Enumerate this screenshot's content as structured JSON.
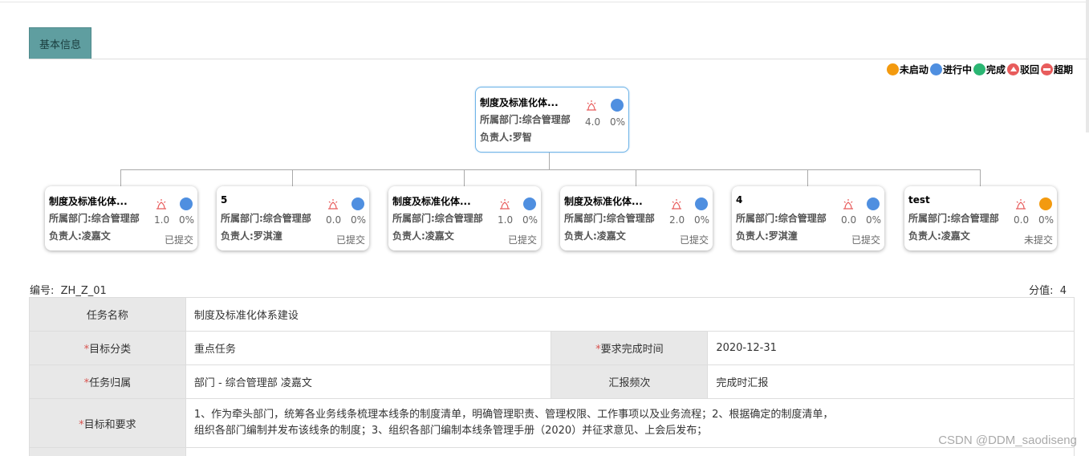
{
  "tabs": [
    {
      "label": "基本信息"
    }
  ],
  "legend": [
    {
      "label": "未启动",
      "color": "#f39a0f"
    },
    {
      "label": "进行中",
      "color": "#4f8fe0"
    },
    {
      "label": "完成",
      "color": "#2bb673"
    },
    {
      "label": "驳回",
      "color": "#e85c5c",
      "icon": "arrow-up-icon"
    },
    {
      "label": "超期",
      "color": "#e85c5c",
      "icon": "minus-icon"
    }
  ],
  "root": {
    "title": "制度及标准化体...",
    "dept": "所属部门:综合管理部",
    "owner": "负责人:罗智",
    "score": "4.0",
    "pct": "0%",
    "status_color": "#4f8fe0"
  },
  "children": [
    {
      "title": "制度及标准化体...",
      "dept": "所属部门:综合管理部",
      "owner": "负责人:凌嘉文",
      "score": "1.0",
      "pct": "0%",
      "state": "已提交",
      "status_color": "#4f8fe0"
    },
    {
      "title": "5",
      "dept": "所属部门:综合管理部",
      "owner": "负责人:罗淇潼",
      "score": "0.0",
      "pct": "0%",
      "state": "已提交",
      "status_color": "#4f8fe0"
    },
    {
      "title": "制度及标准化体...",
      "dept": "所属部门:综合管理部",
      "owner": "负责人:凌嘉文",
      "score": "1.0",
      "pct": "0%",
      "state": "已提交",
      "status_color": "#4f8fe0"
    },
    {
      "title": "制度及标准化体...",
      "dept": "所属部门:综合管理部",
      "owner": "负责人:凌嘉文",
      "score": "2.0",
      "pct": "0%",
      "state": "已提交",
      "status_color": "#4f8fe0"
    },
    {
      "title": "4",
      "dept": "所属部门:综合管理部",
      "owner": "负责人:罗淇潼",
      "score": "0.0",
      "pct": "0%",
      "state": "已提交",
      "status_color": "#4f8fe0"
    },
    {
      "title": "test",
      "dept": "所属部门:综合管理部",
      "owner": "负责人:凌嘉文",
      "score": "0.0",
      "pct": "0%",
      "state": "未提交",
      "status_color": "#f39a0f"
    }
  ],
  "meta": {
    "code_label": "编号:",
    "code_value": "ZH_Z_01",
    "score_label": "分值:",
    "score_value": "4"
  },
  "table": {
    "task_name_label": "任务名称",
    "task_name_value": "制度及标准化体系建设",
    "target_category_label": "目标分类",
    "target_category_value": "重点任务",
    "deadline_label": "要求完成时间",
    "deadline_value": "2020-12-31",
    "belongs_label": "任务归属",
    "belongs_value": "部门 - 综合管理部 凌嘉文",
    "report_freq_label": "汇报频次",
    "report_freq_value": "完成时汇报",
    "goal_label": "目标和要求",
    "goal_value_line1": "1、作为牵头部门，统筹各业务线条梳理本线条的制度清单，明确管理职责、管理权限、工作事项以及业务流程；2、根据确定的制度清单，",
    "goal_value_line2": "组织各部门编制并发布该线条的制度；3、组织各部门编制本线条管理手册（2020）并征求意见、上会后发布；",
    "required_mark": "*"
  },
  "watermark": "CSDN @DDM_saodiseng"
}
